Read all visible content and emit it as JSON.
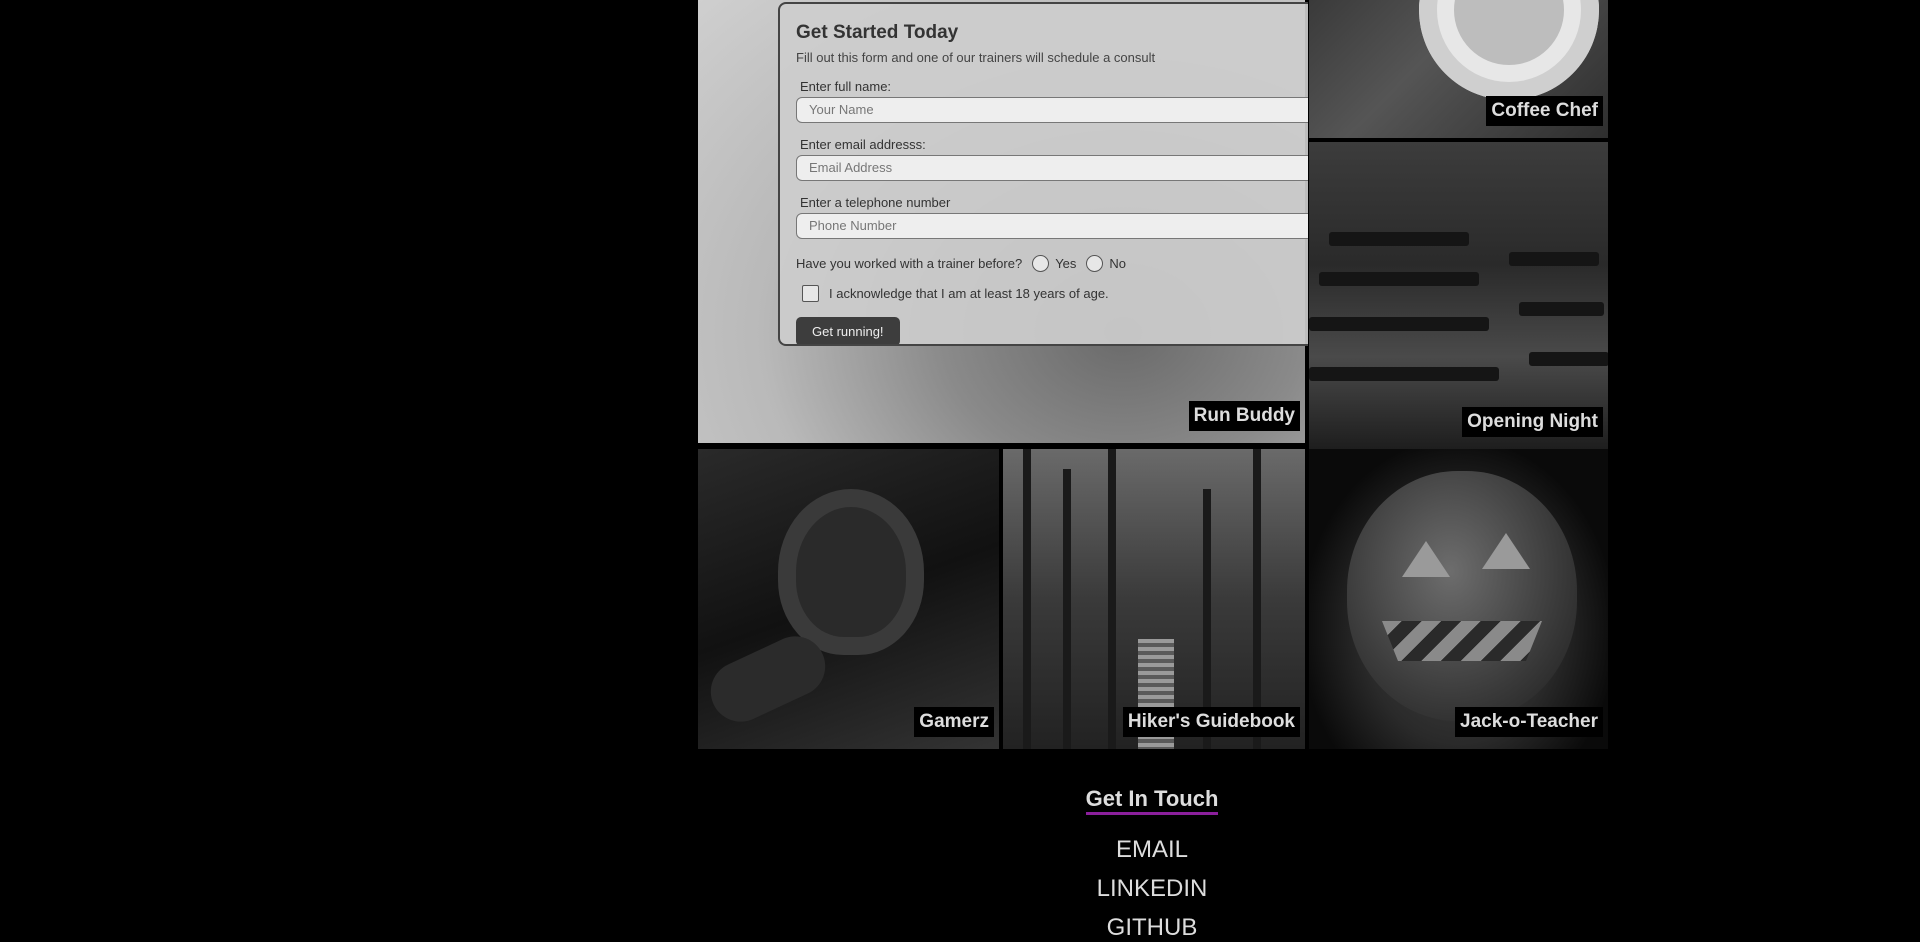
{
  "portfolio": {
    "tiles": [
      {
        "label": "Run Buddy"
      },
      {
        "label": "Coffee Chef"
      },
      {
        "label": "Opening Night"
      },
      {
        "label": "Gamerz"
      },
      {
        "label": "Hiker's Guidebook"
      },
      {
        "label": "Jack-o-Teacher"
      }
    ]
  },
  "form": {
    "title": "Get Started Today",
    "subtitle": "Fill out this form and one of our trainers will schedule a consult",
    "name_label": "Enter full name:",
    "name_placeholder": "Your Name",
    "email_label": "Enter email addresss:",
    "email_placeholder": "Email Address",
    "phone_label": "Enter a telephone number",
    "phone_placeholder": "Phone Number",
    "question": "Have you worked with a trainer before?",
    "yes": "Yes",
    "no": "No",
    "acknowledge": "I acknowledge that I am at least 18 years of age.",
    "submit": "Get running!"
  },
  "contact": {
    "title": "Get In Touch",
    "links": [
      "EMAIL",
      "LINKEDIN",
      "GITHUB"
    ],
    "accent_color": "#8b1f9c"
  }
}
